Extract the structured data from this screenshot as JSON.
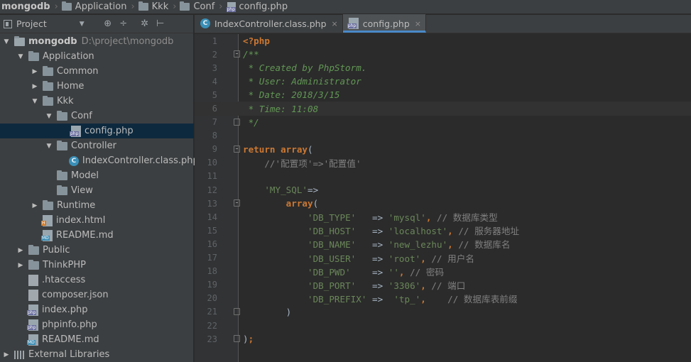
{
  "breadcrumb": [
    "mongodb",
    "Application",
    "Kkk",
    "Conf",
    "config.php"
  ],
  "project_panel": {
    "title": "Project",
    "dropdown_icon": "triangle-down",
    "tools": [
      "sync-icon",
      "collapse-icon",
      "gear-icon",
      "hide-icon"
    ]
  },
  "tree": [
    {
      "label": "mongodb",
      "path": "D:\\project\\mongodb",
      "type": "root",
      "arrow": "down",
      "level": 0
    },
    {
      "label": "Application",
      "type": "folder",
      "arrow": "down",
      "level": 1
    },
    {
      "label": "Common",
      "type": "folder",
      "arrow": "right",
      "level": 2
    },
    {
      "label": "Home",
      "type": "folder",
      "arrow": "right",
      "level": 2
    },
    {
      "label": "Kkk",
      "type": "folder",
      "arrow": "down",
      "level": 2
    },
    {
      "label": "Conf",
      "type": "folder",
      "arrow": "down",
      "level": 3
    },
    {
      "label": "config.php",
      "type": "php",
      "arrow": "none",
      "level": 4,
      "selected": true
    },
    {
      "label": "Controller",
      "type": "folder",
      "arrow": "down",
      "level": 3
    },
    {
      "label": "IndexController.class.php",
      "type": "class",
      "arrow": "none",
      "level": 4
    },
    {
      "label": "Model",
      "type": "folder",
      "arrow": "none",
      "level": 3
    },
    {
      "label": "View",
      "type": "folder",
      "arrow": "none",
      "level": 3
    },
    {
      "label": "Runtime",
      "type": "folder",
      "arrow": "right",
      "level": 2
    },
    {
      "label": "index.html",
      "type": "html",
      "arrow": "none",
      "level": 2
    },
    {
      "label": "README.md",
      "type": "md",
      "arrow": "none",
      "level": 2
    },
    {
      "label": "Public",
      "type": "folder",
      "arrow": "right",
      "level": 1
    },
    {
      "label": "ThinkPHP",
      "type": "folder",
      "arrow": "right",
      "level": 1
    },
    {
      "label": ".htaccess",
      "type": "cfg",
      "arrow": "none",
      "level": 1
    },
    {
      "label": "composer.json",
      "type": "json",
      "arrow": "none",
      "level": 1
    },
    {
      "label": "index.php",
      "type": "php",
      "arrow": "none",
      "level": 1
    },
    {
      "label": "phpinfo.php",
      "type": "php",
      "arrow": "none",
      "level": 1
    },
    {
      "label": "README.md",
      "type": "md",
      "arrow": "none",
      "level": 1
    },
    {
      "label": "External Libraries",
      "type": "libs",
      "arrow": "right",
      "level": 0
    }
  ],
  "tabs": [
    {
      "label": "IndexController.class.php",
      "icon": "class",
      "active": false
    },
    {
      "label": "config.php",
      "icon": "php",
      "active": true
    }
  ],
  "tab_close_glyph": "×",
  "code_lines": [
    {
      "n": "1",
      "tokens": [
        [
          "php-tag",
          "<?php"
        ]
      ]
    },
    {
      "n": "2",
      "tokens": [
        [
          "c",
          "/**"
        ]
      ],
      "fold": "open"
    },
    {
      "n": "3",
      "tokens": [
        [
          "c",
          " * Created by PhpStorm."
        ]
      ]
    },
    {
      "n": "4",
      "tokens": [
        [
          "c",
          " * User: Administrator"
        ]
      ]
    },
    {
      "n": "5",
      "tokens": [
        [
          "c",
          " * Date: 2018/3/15"
        ]
      ]
    },
    {
      "n": "6",
      "tokens": [
        [
          "c",
          " * Time: 11:08"
        ]
      ],
      "current": true
    },
    {
      "n": "7",
      "tokens": [
        [
          "c",
          " */"
        ]
      ],
      "fold": "close"
    },
    {
      "n": "8",
      "tokens": []
    },
    {
      "n": "9",
      "tokens": [
        [
          "k",
          "return"
        ],
        [
          "p",
          " "
        ],
        [
          "k",
          "array"
        ],
        [
          "p",
          "("
        ]
      ],
      "fold": "open"
    },
    {
      "n": "10",
      "tokens": [
        [
          "cm",
          "    //'配置项'=>'配置值'"
        ]
      ]
    },
    {
      "n": "11",
      "tokens": []
    },
    {
      "n": "12",
      "tokens": [
        [
          "p",
          "    "
        ],
        [
          "s",
          "'MY_SQL'"
        ],
        [
          "p",
          "=>"
        ]
      ]
    },
    {
      "n": "13",
      "tokens": [
        [
          "p",
          "        "
        ],
        [
          "k",
          "array"
        ],
        [
          "p",
          "("
        ]
      ],
      "fold": "open"
    },
    {
      "n": "14",
      "tokens": [
        [
          "p",
          "            "
        ],
        [
          "s",
          "'DB_TYPE'"
        ],
        [
          "p",
          "   => "
        ],
        [
          "s",
          "'mysql'"
        ],
        [
          "k",
          ","
        ],
        [
          "cm",
          " // 数据库类型"
        ]
      ]
    },
    {
      "n": "15",
      "tokens": [
        [
          "p",
          "            "
        ],
        [
          "s",
          "'DB_HOST'"
        ],
        [
          "p",
          "   => "
        ],
        [
          "s",
          "'localhost'"
        ],
        [
          "k",
          ","
        ],
        [
          "cm",
          " // 服务器地址"
        ]
      ]
    },
    {
      "n": "16",
      "tokens": [
        [
          "p",
          "            "
        ],
        [
          "s",
          "'DB_NAME'"
        ],
        [
          "p",
          "   => "
        ],
        [
          "s",
          "'new_lezhu'"
        ],
        [
          "k",
          ","
        ],
        [
          "cm",
          " // 数据库名"
        ]
      ]
    },
    {
      "n": "17",
      "tokens": [
        [
          "p",
          "            "
        ],
        [
          "s",
          "'DB_USER'"
        ],
        [
          "p",
          "   => "
        ],
        [
          "s",
          "'root'"
        ],
        [
          "k",
          ","
        ],
        [
          "cm",
          " // 用户名"
        ]
      ]
    },
    {
      "n": "18",
      "tokens": [
        [
          "p",
          "            "
        ],
        [
          "s",
          "'DB_PWD'"
        ],
        [
          "p",
          "    => "
        ],
        [
          "s",
          "''"
        ],
        [
          "k",
          ","
        ],
        [
          "cm",
          " // 密码"
        ]
      ]
    },
    {
      "n": "19",
      "tokens": [
        [
          "p",
          "            "
        ],
        [
          "s",
          "'DB_PORT'"
        ],
        [
          "p",
          "   => "
        ],
        [
          "s",
          "'3306'"
        ],
        [
          "k",
          ","
        ],
        [
          "cm",
          " // 端口"
        ]
      ]
    },
    {
      "n": "20",
      "tokens": [
        [
          "p",
          "            "
        ],
        [
          "s",
          "'DB_PREFIX'"
        ],
        [
          "p",
          " =>  "
        ],
        [
          "s",
          "'tp_'"
        ],
        [
          "k",
          ","
        ],
        [
          "cm",
          "    // 数据库表前缀"
        ]
      ]
    },
    {
      "n": "21",
      "tokens": [
        [
          "p",
          "        )"
        ]
      ],
      "fold": "close"
    },
    {
      "n": "22",
      "tokens": []
    },
    {
      "n": "23",
      "tokens": [
        [
          "p",
          ")"
        ],
        [
          "k",
          ";"
        ]
      ],
      "fold": "close"
    }
  ],
  "colors": {
    "background": "#2b2b2b",
    "panel": "#3c3f41",
    "selection": "#0d293e",
    "keyword": "#cc7832",
    "string": "#6a8759",
    "doc_comment": "#629755",
    "comment": "#808080",
    "tab_underline": "#4a88c7"
  }
}
